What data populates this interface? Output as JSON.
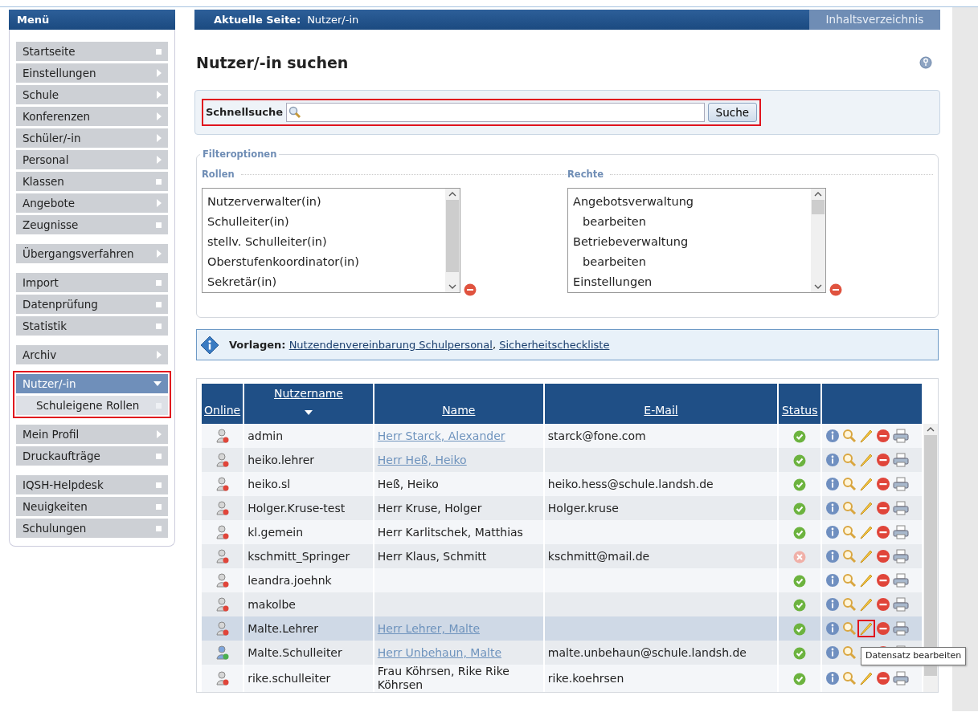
{
  "sidebar": {
    "title": "Menü",
    "groups": [
      {
        "highlighted": false,
        "items": [
          {
            "label": "Startseite",
            "kind": "page",
            "selected": false
          },
          {
            "label": "Einstellungen",
            "kind": "submenu",
            "selected": false,
            "expanded": false
          },
          {
            "label": "Schule",
            "kind": "submenu",
            "selected": false,
            "expanded": false
          },
          {
            "label": "Konferenzen",
            "kind": "submenu",
            "selected": false,
            "expanded": false
          },
          {
            "label": "Schüler/-in",
            "kind": "submenu",
            "selected": false,
            "expanded": false
          },
          {
            "label": "Personal",
            "kind": "submenu",
            "selected": false,
            "expanded": false
          },
          {
            "label": "Klassen",
            "kind": "page",
            "selected": false
          },
          {
            "label": "Angebote",
            "kind": "submenu",
            "selected": false,
            "expanded": false
          },
          {
            "label": "Zeugnisse",
            "kind": "page",
            "selected": false
          }
        ]
      },
      {
        "highlighted": false,
        "items": [
          {
            "label": "Übergangsverfahren",
            "kind": "submenu",
            "selected": false,
            "expanded": false
          }
        ]
      },
      {
        "highlighted": false,
        "items": [
          {
            "label": "Import",
            "kind": "page",
            "selected": false
          },
          {
            "label": "Datenprüfung",
            "kind": "page",
            "selected": false
          },
          {
            "label": "Statistik",
            "kind": "page",
            "selected": false
          }
        ]
      },
      {
        "highlighted": false,
        "items": [
          {
            "label": "Archiv",
            "kind": "submenu",
            "selected": false,
            "expanded": false
          }
        ]
      },
      {
        "highlighted": true,
        "items": [
          {
            "label": "Nutzer/-in",
            "kind": "submenu",
            "selected": true,
            "expanded": true,
            "children": [
              {
                "label": "Schuleigene Rollen",
                "kind": "page",
                "selected": false
              }
            ]
          }
        ]
      },
      {
        "highlighted": false,
        "items": [
          {
            "label": "Mein Profil",
            "kind": "submenu",
            "selected": false,
            "expanded": false
          },
          {
            "label": "Druckaufträge",
            "kind": "page",
            "selected": false
          }
        ]
      },
      {
        "highlighted": false,
        "items": [
          {
            "label": "IQSH-Helpdesk",
            "kind": "page",
            "selected": false
          },
          {
            "label": "Neuigkeiten",
            "kind": "page",
            "selected": false
          },
          {
            "label": "Schulungen",
            "kind": "page",
            "selected": false
          }
        ]
      }
    ]
  },
  "breadcrumb": {
    "label": "Aktuelle Seite:",
    "value": "Nutzer/-in"
  },
  "toc_button": "Inhaltsverzeichnis",
  "heading": "Nutzer/-in suchen",
  "quick_search": {
    "label": "Schnellsuche",
    "button": "Suche",
    "highlighted": true
  },
  "filter": {
    "legend": "Filteroptionen",
    "lists": [
      {
        "label": "Rollen",
        "items": [
          {
            "label": "Nutzerverwalter(in)"
          },
          {
            "label": "Schulleiter(in)"
          },
          {
            "label": "stellv. Schulleiter(in)"
          },
          {
            "label": "Oberstufenkoordinator(in)"
          },
          {
            "label": "Sekretär(in)"
          }
        ]
      },
      {
        "label": "Rechte",
        "items": [
          {
            "label": "Angebotsverwaltung",
            "children": [
              {
                "label": "bearbeiten"
              }
            ]
          },
          {
            "label": "Betriebeverwaltung",
            "children": [
              {
                "label": "bearbeiten"
              }
            ]
          },
          {
            "label": "Einstellungen"
          }
        ]
      }
    ]
  },
  "templates": {
    "label": "Vorlagen:",
    "links": [
      "Nutzendenvereinbarung Schulpersonal",
      "Sicherheitscheckliste"
    ],
    "separator": ","
  },
  "table": {
    "columns": [
      {
        "label": "Online",
        "sorted": false
      },
      {
        "label": "Nutzername",
        "sorted": true
      },
      {
        "label": "Name",
        "sorted": false
      },
      {
        "label": "E-Mail",
        "sorted": false
      },
      {
        "label": "Status",
        "sorted": false
      }
    ],
    "tooltip": "Datensatz bearbeiten",
    "rows": [
      {
        "online": false,
        "username": "admin",
        "name": "Herr Starck, Alexander",
        "name_link": true,
        "email": "starck@fone.com",
        "active": true,
        "hovered": false,
        "edit_highlighted": false
      },
      {
        "online": false,
        "username": "heiko.lehrer",
        "name": "Herr Heß, Heiko",
        "name_link": true,
        "email": "",
        "active": true,
        "hovered": false,
        "edit_highlighted": false
      },
      {
        "online": false,
        "username": "heiko.sl",
        "name": "Heß, Heiko",
        "name_link": false,
        "email": "heiko.hess@schule.landsh.de",
        "active": true,
        "hovered": false,
        "edit_highlighted": false
      },
      {
        "online": false,
        "username": "Holger.Kruse-test",
        "name": "Herr Kruse, Holger",
        "name_link": false,
        "email": "Holger.kruse",
        "active": true,
        "hovered": false,
        "edit_highlighted": false
      },
      {
        "online": false,
        "username": "kl.gemein",
        "name": "Herr Karlitschek, Matthias",
        "name_link": false,
        "email": "",
        "active": true,
        "hovered": false,
        "edit_highlighted": false
      },
      {
        "online": false,
        "username": "kschmitt_Springer",
        "name": "Herr Klaus, Schmitt",
        "name_link": false,
        "email": "kschmitt@mail.de",
        "active": false,
        "hovered": false,
        "edit_highlighted": false
      },
      {
        "online": false,
        "username": "leandra.joehnk",
        "name": "",
        "email": "",
        "active": true,
        "hovered": false,
        "edit_highlighted": false
      },
      {
        "online": false,
        "username": "makolbe",
        "name": "",
        "email": "",
        "active": true,
        "hovered": false,
        "edit_highlighted": false
      },
      {
        "online": false,
        "username": "Malte.Lehrer",
        "name": "Herr Lehrer, Malte",
        "name_link": true,
        "email": "",
        "active": true,
        "hovered": true,
        "edit_highlighted": true
      },
      {
        "online": true,
        "username": "Malte.Schulleiter",
        "name": "Herr Unbehaun, Malte",
        "name_link": true,
        "email": "malte.unbehaun@schule.landsh.de",
        "active": true,
        "hovered": false,
        "edit_highlighted": false
      },
      {
        "online": false,
        "username": "rike.schulleiter",
        "name": "Frau Köhrsen, Rike Rike Köhrsen",
        "name_link": false,
        "email": "rike.koehrsen",
        "active": true,
        "hovered": false,
        "edit_highlighted": false
      }
    ]
  }
}
